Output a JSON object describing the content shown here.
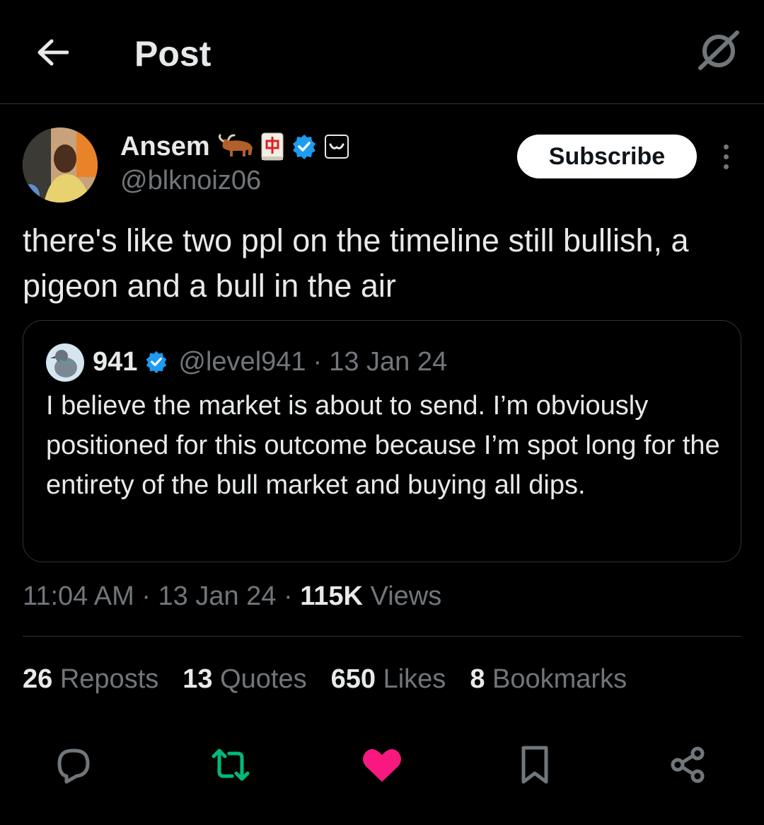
{
  "header": {
    "title": "Post"
  },
  "author": {
    "name": "Ansem",
    "handle": "@blknoiz06",
    "subscribe_label": "Subscribe"
  },
  "post": {
    "text": "there's like two ppl on the timeline still bullish, a pigeon and a bull in the air",
    "time": "11:04 AM",
    "date": "13 Jan 24",
    "views_count": "115K",
    "views_label": "Views",
    "separator": "·"
  },
  "quote": {
    "name": "941",
    "handle": "@level941",
    "date": "13 Jan 24",
    "separator": "·",
    "text": "I believe the market is about to send. I’m obviously positioned for this outcome because I’m spot long for the entirety of the bull market and buying all dips."
  },
  "stats": [
    {
      "count": "26",
      "label": "Reposts"
    },
    {
      "count": "13",
      "label": "Quotes"
    },
    {
      "count": "650",
      "label": "Likes"
    },
    {
      "count": "8",
      "label": "Bookmarks"
    }
  ],
  "actions": [
    {
      "icon": "reply-icon"
    },
    {
      "icon": "repost-icon",
      "color": "#00ba7c"
    },
    {
      "icon": "like-icon",
      "color": "#f91880"
    },
    {
      "icon": "bookmark-icon"
    },
    {
      "icon": "share-icon"
    }
  ],
  "colors": {
    "background": "#000000",
    "text": "#e7e9ea",
    "secondary": "#71767b",
    "verified": "#1d9bf0",
    "repost": "#00ba7c",
    "like": "#f91880"
  }
}
